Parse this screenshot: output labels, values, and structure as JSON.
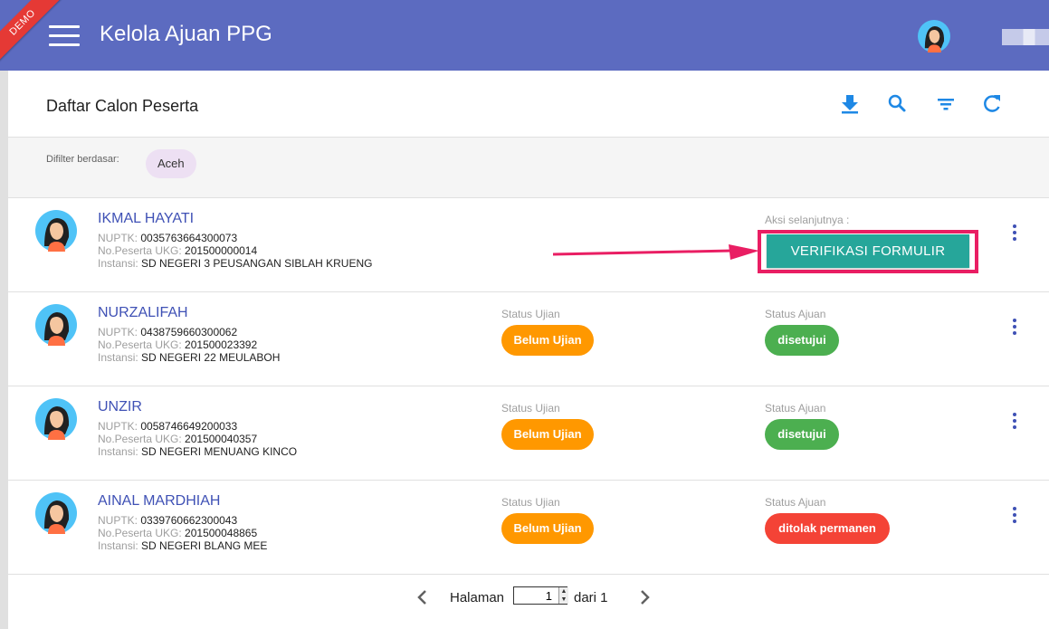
{
  "app": {
    "title": "Kelola Ajuan PPG",
    "demo_badge": "DEMO",
    "accent_color": "#5c6bc0"
  },
  "card": {
    "title": "Daftar Calon Peserta",
    "toolbar": [
      "download-icon",
      "search-icon",
      "filter-icon",
      "refresh-icon"
    ]
  },
  "filter": {
    "label": "Difilter berdasar:",
    "chip": "Aceh"
  },
  "labels": {
    "nuptk": "NUPTK:",
    "no_peserta": "No.Peserta UKG:",
    "instansi": "Instansi:",
    "status_ujian": "Status Ujian",
    "status_ajuan": "Status Ajuan",
    "aksi": "Aksi selanjutnya :"
  },
  "rows": [
    {
      "name": "IKMAL HAYATI",
      "nuptk": "0035763664300073",
      "no_peserta": "201500000014",
      "instansi": "SD NEGERI 3 PEUSANGAN SIBLAH KRUENG",
      "action": "VERIFIKASI FORMULIR"
    },
    {
      "name": "NURZALIFAH",
      "nuptk": "0438759660300062",
      "no_peserta": "201500023392",
      "instansi": "SD NEGERI 22 MEULABOH",
      "status_ujian": "Belum Ujian",
      "status_ajuan": "disetujui"
    },
    {
      "name": "UNZIR",
      "nuptk": "0058746649200033",
      "no_peserta": "201500040357",
      "instansi": "SD NEGERI MENUANG KINCO",
      "status_ujian": "Belum Ujian",
      "status_ajuan": "disetujui"
    },
    {
      "name": "AINAL MARDHIAH",
      "nuptk": "0339760662300043",
      "no_peserta": "201500048865",
      "instansi": "SD NEGERI BLANG MEE",
      "status_ujian": "Belum Ujian",
      "status_ajuan": "ditolak permanen"
    }
  ],
  "pagination": {
    "prefix": "Halaman",
    "current_page": "1",
    "suffix": "dari 1"
  }
}
